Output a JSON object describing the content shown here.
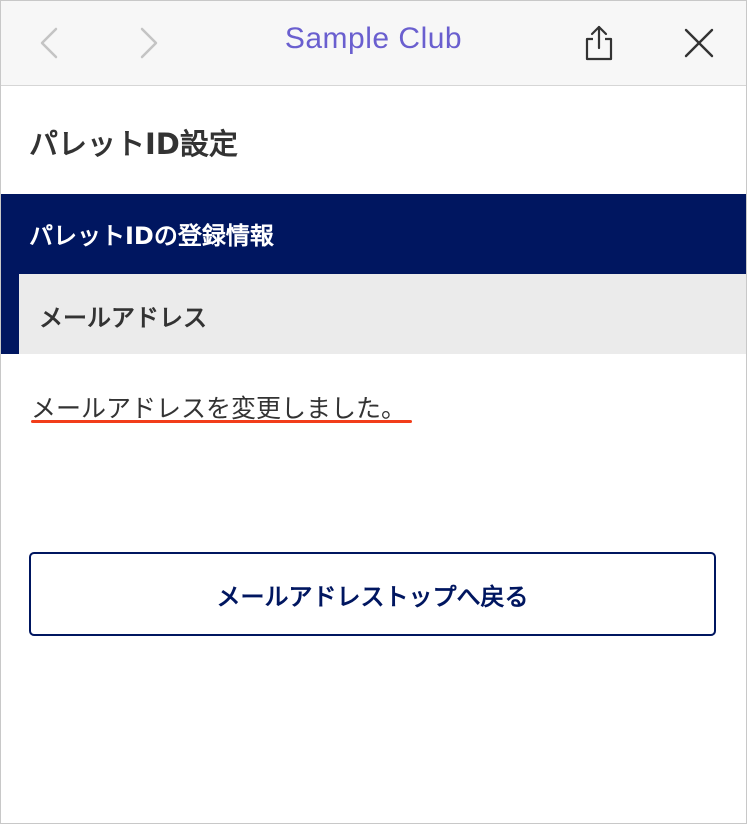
{
  "browser": {
    "title": "Sample Club",
    "icons": {
      "back": "chevron-left-icon",
      "forward": "chevron-right-icon",
      "share": "share-icon",
      "close": "close-icon"
    }
  },
  "page": {
    "title": "パレットID設定"
  },
  "section": {
    "title": "パレットIDの登録情報",
    "subsection_title": "メールアドレス"
  },
  "message": {
    "text": "メールアドレスを変更しました。"
  },
  "actions": {
    "back_button_label": "メールアドレストップへ戻る"
  },
  "colors": {
    "navy": "#001660",
    "accent_underline": "#f23d1a",
    "title_purple": "#6a5fcf",
    "gray_band": "#ebebeb"
  }
}
